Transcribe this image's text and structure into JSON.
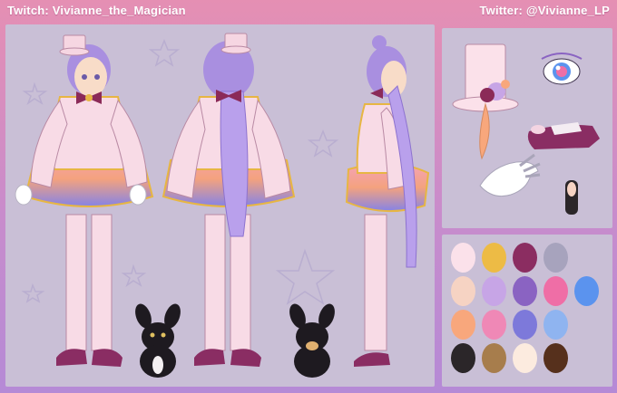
{
  "header": {
    "twitch_label": "Twitch: Vivianne_the_Magician",
    "twitter_label": "Twitter: @Vivianne_LP"
  },
  "colors": {
    "hair": "#a98fe0",
    "coat": "#f8dbe6",
    "coat_trim": "#e7b643",
    "ruffle_top": "#f09fb8",
    "ruffle_bottom": "#8a86e8",
    "bow": "#8b2a58",
    "shoes": "#8a2d63",
    "skin": "#f8dcc8",
    "bunny": "#1e1a20"
  },
  "palette": [
    [
      "#fbe1ea",
      "#edbb45",
      "#8b2d61",
      "#a7a3bd"
    ],
    [
      "#f6d3c3",
      "#c7a5e6",
      "#8a63c2",
      "#ef6ea6",
      "#5b93ee"
    ],
    [
      "#f8a77c",
      "#ef88b6",
      "#7d79da",
      "#8fb4f0"
    ],
    [
      "#2b2629",
      "#a77d4c",
      "#fcebdf",
      "#56301c"
    ]
  ]
}
